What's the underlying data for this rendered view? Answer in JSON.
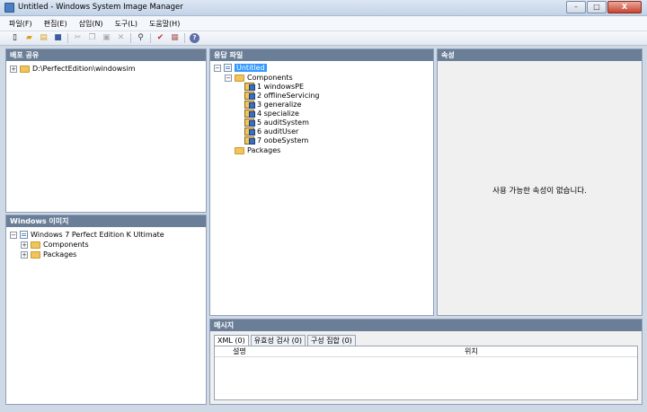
{
  "window": {
    "title": "Untitled - Windows System Image Manager",
    "minimize": "–",
    "maximize": "□",
    "close": "X"
  },
  "menu": [
    "파일(F)",
    "편집(E)",
    "삽입(N)",
    "도구(L)",
    "도움말(H)"
  ],
  "toolbar_icons": [
    "new-icon",
    "open-icon",
    "open-folder-icon",
    "save-icon",
    "cut-icon",
    "copy-icon",
    "paste-icon",
    "delete-icon",
    "find-icon",
    "validate-icon",
    "create-config-icon",
    "help-icon"
  ],
  "distribution_share": {
    "header": "배포 공유",
    "items": [
      {
        "label": "D:\\PerfectEdition\\windowsim"
      }
    ]
  },
  "windows_image": {
    "header": "Windows 이미지",
    "root": "Windows 7 Perfect Edition K Ultimate",
    "children": [
      "Components",
      "Packages"
    ]
  },
  "answer_file": {
    "header": "응답 파일",
    "root": "Untitled",
    "components": "Components",
    "passes": [
      "1 windowsPE",
      "2 offlineServicing",
      "3 generalize",
      "4 specialize",
      "5 auditSystem",
      "6 auditUser",
      "7 oobeSystem"
    ],
    "packages": "Packages"
  },
  "properties": {
    "header": "속성",
    "empty_message": "사용 가능한 속성이 없습니다."
  },
  "messages": {
    "header": "메시지",
    "tabs": [
      "XML (0)",
      "유효성 검사 (0)",
      "구성 집합 (0)"
    ],
    "columns": [
      "설명",
      "위치"
    ]
  },
  "colors": {
    "panel_header": "#6a7e97",
    "selection": "#3399ff",
    "folder": "#f1c45c"
  }
}
